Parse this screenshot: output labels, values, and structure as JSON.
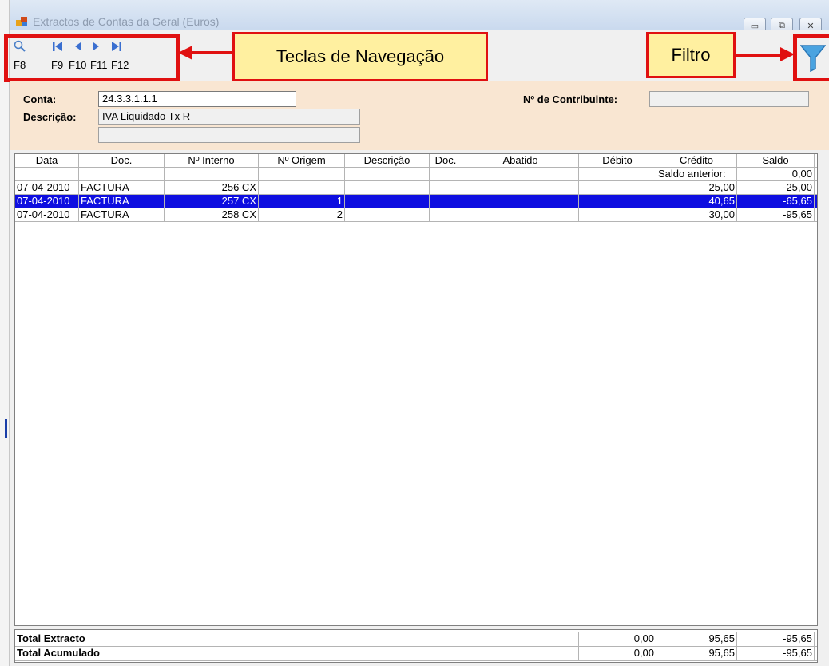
{
  "window": {
    "title": "Extractos de Contas da Geral (Euros)",
    "minimize_glyph": "▭",
    "maximize_glyph": "⧉",
    "close_glyph": "✕"
  },
  "toolbar": {
    "keys": [
      {
        "label": "F8",
        "icon": "search-icon"
      },
      {
        "label": "F9",
        "icon": "first-record-icon"
      },
      {
        "label": "F10",
        "icon": "previous-record-icon"
      },
      {
        "label": "F11",
        "icon": "next-record-icon"
      },
      {
        "label": "F12",
        "icon": "last-record-icon"
      }
    ],
    "filter_icon": "filter-icon"
  },
  "annotations": {
    "nav_callout": "Teclas de Navegação",
    "filter_callout": "Filtro",
    "color": "#e01010",
    "callout_bg": "#fff0a0"
  },
  "account": {
    "conta_label": "Conta:",
    "conta_value": "24.3.3.1.1.1",
    "descricao_label": "Descrição:",
    "descricao_value": "IVA Liquidado Tx R",
    "descricao_value2": "",
    "contribuinte_label": "Nº de Contribuinte:",
    "contribuinte_value": ""
  },
  "grid": {
    "columns": [
      "Data",
      "Doc.",
      "Nº Interno",
      "Nº Origem",
      "Descrição",
      "Doc.",
      "Abatido",
      "Débito",
      "Crédito",
      "Saldo"
    ],
    "saldo_anterior": {
      "label": "Saldo anterior:",
      "value": "0,00"
    },
    "rows": [
      {
        "data": "07-04-2010",
        "doc": "FACTURA",
        "interno": "256 CX",
        "origem": "",
        "descricao": "",
        "doc2": "",
        "abatido": "",
        "debito": "",
        "credito": "25,00",
        "saldo": "-25,00",
        "selected": false
      },
      {
        "data": "07-04-2010",
        "doc": "FACTURA",
        "interno": "257 CX",
        "origem": "1",
        "descricao": "",
        "doc2": "",
        "abatido": "",
        "debito": "",
        "credito": "40,65",
        "saldo": "-65,65",
        "selected": true
      },
      {
        "data": "07-04-2010",
        "doc": "FACTURA",
        "interno": "258 CX",
        "origem": "2",
        "descricao": "",
        "doc2": "",
        "abatido": "",
        "debito": "",
        "credito": "30,00",
        "saldo": "-95,65",
        "selected": false
      }
    ],
    "selection_color": "#0e0ee0"
  },
  "totals": {
    "extracto": {
      "label": "Total Extracto",
      "debito": "0,00",
      "credito": "95,65",
      "saldo": "-95,65"
    },
    "acumulado": {
      "label": "Total Acumulado",
      "debito": "0,00",
      "credito": "95,65",
      "saldo": "-95,65"
    }
  }
}
